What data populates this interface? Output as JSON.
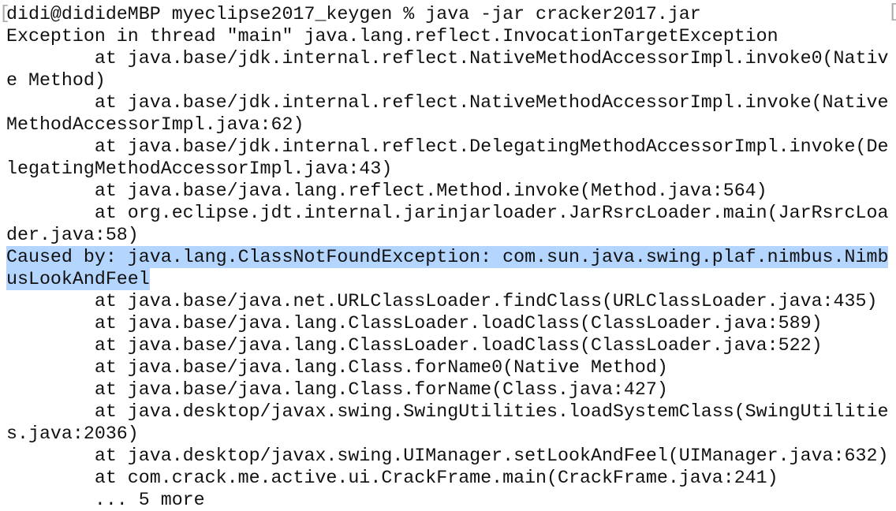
{
  "terminal": {
    "rows": [
      {
        "text": "didi@dididеMBP myeclipse2017_keygen % java -jar cracker2017.jar",
        "highlight": false
      },
      {
        "text": "Exception in thread \"main\" java.lang.reflect.InvocationTargetException",
        "highlight": false
      },
      {
        "text": "        at java.base/jdk.internal.reflect.NativeMethodAccessorImpl.invoke0(Nativ",
        "highlight": false
      },
      {
        "text": "e Method)",
        "highlight": false
      },
      {
        "text": "        at java.base/jdk.internal.reflect.NativeMethodAccessorImpl.invoke(Native",
        "highlight": false
      },
      {
        "text": "MethodAccessorImpl.java:62)",
        "highlight": false
      },
      {
        "text": "        at java.base/jdk.internal.reflect.DelegatingMethodAccessorImpl.invoke(De",
        "highlight": false
      },
      {
        "text": "legatingMethodAccessorImpl.java:43)",
        "highlight": false
      },
      {
        "text": "        at java.base/java.lang.reflect.Method.invoke(Method.java:564)",
        "highlight": false
      },
      {
        "text": "        at org.eclipse.jdt.internal.jarinjarloader.JarRsrcLoader.main(JarRsrcLoa",
        "highlight": false
      },
      {
        "text": "der.java:58)",
        "highlight": false
      },
      {
        "text": "Caused by: java.lang.ClassNotFoundException: com.sun.java.swing.plaf.nimbus.Nimb",
        "highlight": true
      },
      {
        "text": "usLookAndFeel",
        "highlight": true
      },
      {
        "text": "        at java.base/java.net.URLClassLoader.findClass(URLClassLoader.java:435)",
        "highlight": false
      },
      {
        "text": "        at java.base/java.lang.ClassLoader.loadClass(ClassLoader.java:589)",
        "highlight": false
      },
      {
        "text": "        at java.base/java.lang.ClassLoader.loadClass(ClassLoader.java:522)",
        "highlight": false
      },
      {
        "text": "        at java.base/java.lang.Class.forName0(Native Method)",
        "highlight": false
      },
      {
        "text": "        at java.base/java.lang.Class.forName(Class.java:427)",
        "highlight": false
      },
      {
        "text": "        at java.desktop/javax.swing.SwingUtilities.loadSystemClass(SwingUtilitie",
        "highlight": false
      },
      {
        "text": "s.java:2036)",
        "highlight": false
      },
      {
        "text": "        at java.desktop/javax.swing.UIManager.setLookAndFeel(UIManager.java:632)",
        "highlight": false
      },
      {
        "text": "        at com.crack.me.active.ui.CrackFrame.main(CrackFrame.java:241)",
        "highlight": false
      },
      {
        "text": "        ... 5 more",
        "highlight": false
      }
    ],
    "left_mark": "[",
    "right_mark": "[",
    "selection_color": "#b4d5fe"
  }
}
